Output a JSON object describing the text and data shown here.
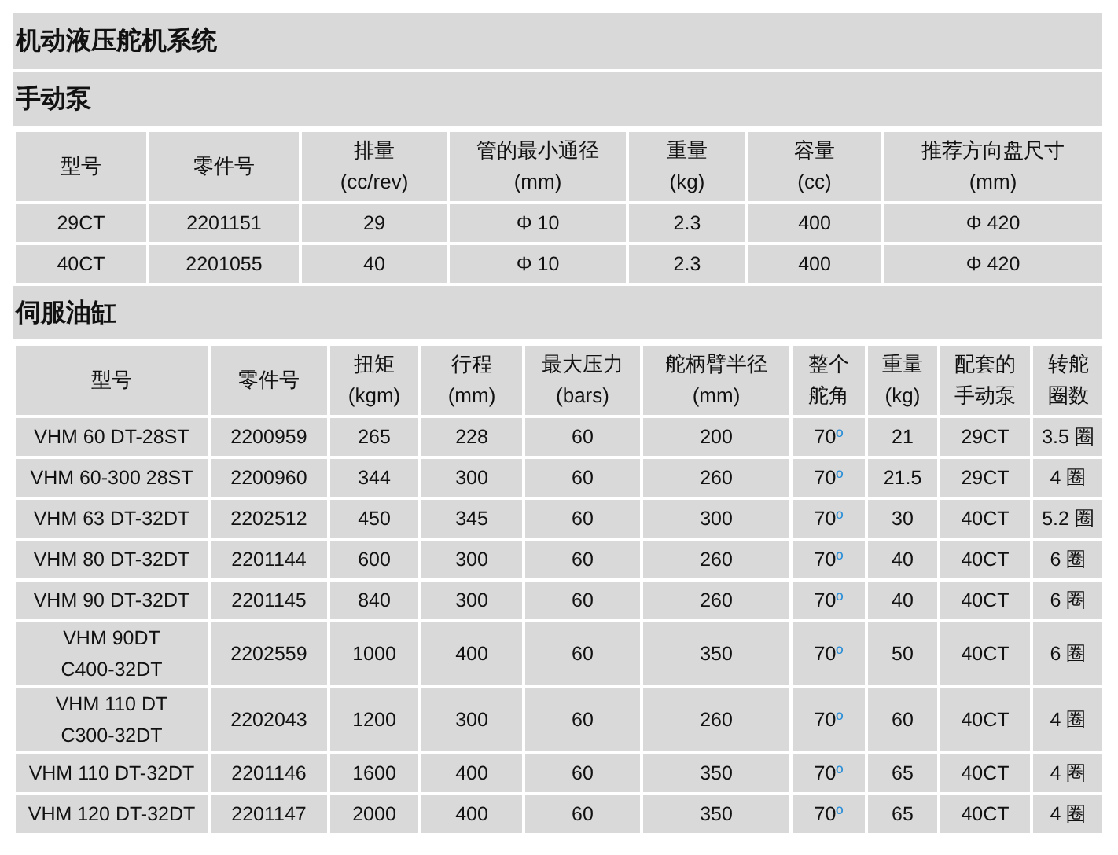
{
  "title": "机动液压舵机系统",
  "pump": {
    "title": "手动泵",
    "columns": [
      "型号",
      "零件号",
      "排量\n(cc/rev)",
      "管的最小通径\n(mm)",
      "重量\n(kg)",
      "容量\n(cc)",
      "推荐方向盘尺寸\n(mm)"
    ],
    "rows": [
      [
        "29CT",
        "2201151",
        "29",
        "Φ 10",
        "2.3",
        "400",
        "Φ 420"
      ],
      [
        "40CT",
        "2201055",
        "40",
        "Φ 10",
        "2.3",
        "400",
        "Φ 420"
      ]
    ]
  },
  "cylinder": {
    "title": "伺服油缸",
    "columns": [
      "型号",
      "零件号",
      "扭矩\n(kgm)",
      "行程\n(mm)",
      "最大压力\n(bars)",
      "舵柄臂半径\n(mm)",
      "整个舵角",
      "重量\n(kg)",
      "配套的手动泵",
      "转舵圈数"
    ],
    "rows": [
      [
        "VHM 60 DT-28ST",
        "2200959",
        "265",
        "228",
        "60",
        "200",
        "70º",
        "21",
        "29CT",
        "3.5 圈"
      ],
      [
        "VHM 60-300 28ST",
        "2200960",
        "344",
        "300",
        "60",
        "260",
        "70º",
        "21.5",
        "29CT",
        "4 圈"
      ],
      [
        "VHM 63 DT-32DT",
        "2202512",
        "450",
        "345",
        "60",
        "300",
        "70º",
        "30",
        "40CT",
        "5.2 圈"
      ],
      [
        "VHM 80 DT-32DT",
        "2201144",
        "600",
        "300",
        "60",
        "260",
        "70º",
        "40",
        "40CT",
        "6 圈"
      ],
      [
        "VHM 90 DT-32DT",
        "2201145",
        "840",
        "300",
        "60",
        "260",
        "70º",
        "40",
        "40CT",
        "6 圈"
      ],
      [
        "VHM 90DT\nC400-32DT",
        "2202559",
        "1000",
        "400",
        "60",
        "350",
        "70º",
        "50",
        "40CT",
        "6 圈"
      ],
      [
        "VHM 110 DT\nC300-32DT",
        "2202043",
        "1200",
        "300",
        "60",
        "260",
        "70º",
        "60",
        "40CT",
        "4 圈"
      ],
      [
        "VHM 110 DT-32DT",
        "2201146",
        "1600",
        "400",
        "60",
        "350",
        "70º",
        "65",
        "40CT",
        "4 圈"
      ],
      [
        "VHM 120 DT-32DT",
        "2201147",
        "2000",
        "400",
        "60",
        "350",
        "70º",
        "65",
        "40CT",
        "4 圈"
      ]
    ]
  }
}
